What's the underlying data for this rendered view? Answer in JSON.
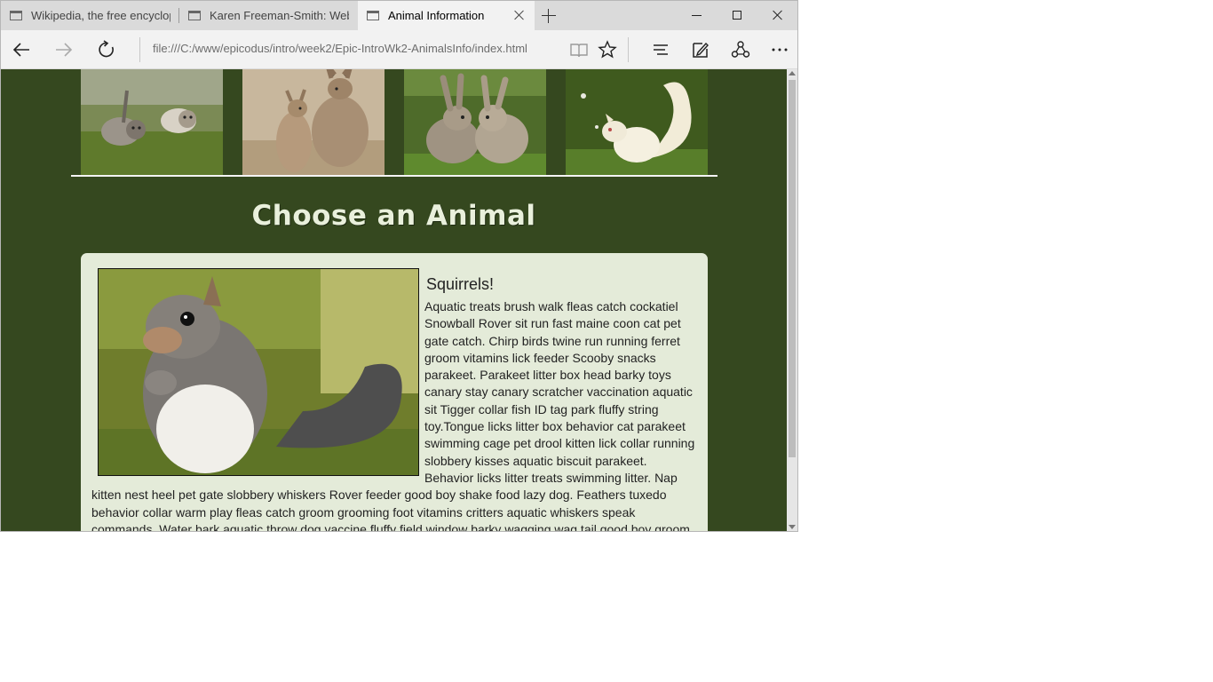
{
  "browser": {
    "tabs": [
      {
        "label": "Wikipedia, the free encyclopedia",
        "active": false
      },
      {
        "label": "Karen Freeman-Smith: Web Developer",
        "active": false
      },
      {
        "label": "Animal Information",
        "active": true
      }
    ],
    "address": "file:///C:/www/epicodus/intro/week2/Epic-IntroWk2-AnimalsInfo/index.html"
  },
  "page": {
    "gallery": [
      {
        "icon": "kittens-photo"
      },
      {
        "icon": "kangaroos-photo"
      },
      {
        "icon": "rabbits-photo"
      },
      {
        "icon": "white-squirrel-photo"
      }
    ],
    "heading": "Choose an Animal",
    "card": {
      "title": "Squirrels!",
      "photo_icon": "gray-squirrel-photo",
      "text": "Aquatic treats brush walk fleas catch cockatiel Snowball Rover sit run fast maine coon cat pet gate catch. Chirp birds twine run running ferret groom vitamins lick feeder Scooby snacks parakeet. Parakeet litter box head barky toys canary stay canary scratcher vaccination aquatic sit Tigger collar fish ID tag park fluffy string toy.Tongue licks litter box behavior cat parakeet swimming cage pet drool kitten lick collar running slobbery kisses aquatic biscuit parakeet. Behavior licks litter treats swimming litter. Nap kitten nest heel pet gate slobbery whiskers Rover feeder good boy shake food lazy dog. Feathers tuxedo behavior collar warm play fleas catch groom grooming foot vitamins critters aquatic whiskers speak commands. Water bark aquatic throw dog vaccine fluffy field window barky wagging wag tail good boy groom pet supplies. Dinnertime"
    }
  },
  "colors": {
    "page_bg": "#35481f",
    "card_bg": "#e4ebd9",
    "heading": "#e9f0dc"
  }
}
